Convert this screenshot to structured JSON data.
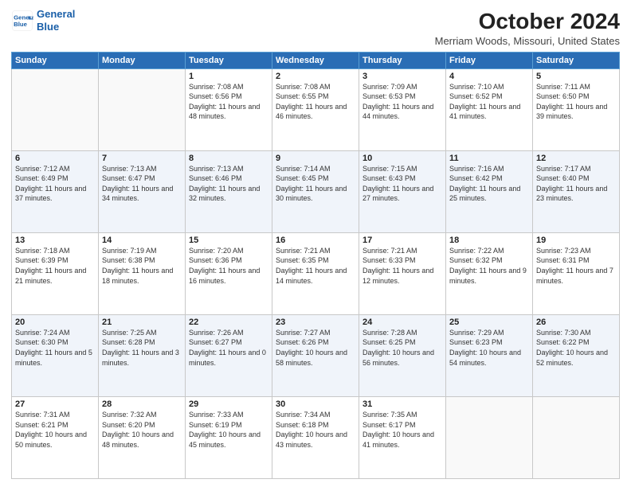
{
  "header": {
    "logo_line1": "General",
    "logo_line2": "Blue",
    "title": "October 2024",
    "subtitle": "Merriam Woods, Missouri, United States"
  },
  "weekdays": [
    "Sunday",
    "Monday",
    "Tuesday",
    "Wednesday",
    "Thursday",
    "Friday",
    "Saturday"
  ],
  "weeks": [
    [
      {
        "day": "",
        "sunrise": "",
        "sunset": "",
        "daylight": ""
      },
      {
        "day": "",
        "sunrise": "",
        "sunset": "",
        "daylight": ""
      },
      {
        "day": "1",
        "sunrise": "Sunrise: 7:08 AM",
        "sunset": "Sunset: 6:56 PM",
        "daylight": "Daylight: 11 hours and 48 minutes."
      },
      {
        "day": "2",
        "sunrise": "Sunrise: 7:08 AM",
        "sunset": "Sunset: 6:55 PM",
        "daylight": "Daylight: 11 hours and 46 minutes."
      },
      {
        "day": "3",
        "sunrise": "Sunrise: 7:09 AM",
        "sunset": "Sunset: 6:53 PM",
        "daylight": "Daylight: 11 hours and 44 minutes."
      },
      {
        "day": "4",
        "sunrise": "Sunrise: 7:10 AM",
        "sunset": "Sunset: 6:52 PM",
        "daylight": "Daylight: 11 hours and 41 minutes."
      },
      {
        "day": "5",
        "sunrise": "Sunrise: 7:11 AM",
        "sunset": "Sunset: 6:50 PM",
        "daylight": "Daylight: 11 hours and 39 minutes."
      }
    ],
    [
      {
        "day": "6",
        "sunrise": "Sunrise: 7:12 AM",
        "sunset": "Sunset: 6:49 PM",
        "daylight": "Daylight: 11 hours and 37 minutes."
      },
      {
        "day": "7",
        "sunrise": "Sunrise: 7:13 AM",
        "sunset": "Sunset: 6:47 PM",
        "daylight": "Daylight: 11 hours and 34 minutes."
      },
      {
        "day": "8",
        "sunrise": "Sunrise: 7:13 AM",
        "sunset": "Sunset: 6:46 PM",
        "daylight": "Daylight: 11 hours and 32 minutes."
      },
      {
        "day": "9",
        "sunrise": "Sunrise: 7:14 AM",
        "sunset": "Sunset: 6:45 PM",
        "daylight": "Daylight: 11 hours and 30 minutes."
      },
      {
        "day": "10",
        "sunrise": "Sunrise: 7:15 AM",
        "sunset": "Sunset: 6:43 PM",
        "daylight": "Daylight: 11 hours and 27 minutes."
      },
      {
        "day": "11",
        "sunrise": "Sunrise: 7:16 AM",
        "sunset": "Sunset: 6:42 PM",
        "daylight": "Daylight: 11 hours and 25 minutes."
      },
      {
        "day": "12",
        "sunrise": "Sunrise: 7:17 AM",
        "sunset": "Sunset: 6:40 PM",
        "daylight": "Daylight: 11 hours and 23 minutes."
      }
    ],
    [
      {
        "day": "13",
        "sunrise": "Sunrise: 7:18 AM",
        "sunset": "Sunset: 6:39 PM",
        "daylight": "Daylight: 11 hours and 21 minutes."
      },
      {
        "day": "14",
        "sunrise": "Sunrise: 7:19 AM",
        "sunset": "Sunset: 6:38 PM",
        "daylight": "Daylight: 11 hours and 18 minutes."
      },
      {
        "day": "15",
        "sunrise": "Sunrise: 7:20 AM",
        "sunset": "Sunset: 6:36 PM",
        "daylight": "Daylight: 11 hours and 16 minutes."
      },
      {
        "day": "16",
        "sunrise": "Sunrise: 7:21 AM",
        "sunset": "Sunset: 6:35 PM",
        "daylight": "Daylight: 11 hours and 14 minutes."
      },
      {
        "day": "17",
        "sunrise": "Sunrise: 7:21 AM",
        "sunset": "Sunset: 6:33 PM",
        "daylight": "Daylight: 11 hours and 12 minutes."
      },
      {
        "day": "18",
        "sunrise": "Sunrise: 7:22 AM",
        "sunset": "Sunset: 6:32 PM",
        "daylight": "Daylight: 11 hours and 9 minutes."
      },
      {
        "day": "19",
        "sunrise": "Sunrise: 7:23 AM",
        "sunset": "Sunset: 6:31 PM",
        "daylight": "Daylight: 11 hours and 7 minutes."
      }
    ],
    [
      {
        "day": "20",
        "sunrise": "Sunrise: 7:24 AM",
        "sunset": "Sunset: 6:30 PM",
        "daylight": "Daylight: 11 hours and 5 minutes."
      },
      {
        "day": "21",
        "sunrise": "Sunrise: 7:25 AM",
        "sunset": "Sunset: 6:28 PM",
        "daylight": "Daylight: 11 hours and 3 minutes."
      },
      {
        "day": "22",
        "sunrise": "Sunrise: 7:26 AM",
        "sunset": "Sunset: 6:27 PM",
        "daylight": "Daylight: 11 hours and 0 minutes."
      },
      {
        "day": "23",
        "sunrise": "Sunrise: 7:27 AM",
        "sunset": "Sunset: 6:26 PM",
        "daylight": "Daylight: 10 hours and 58 minutes."
      },
      {
        "day": "24",
        "sunrise": "Sunrise: 7:28 AM",
        "sunset": "Sunset: 6:25 PM",
        "daylight": "Daylight: 10 hours and 56 minutes."
      },
      {
        "day": "25",
        "sunrise": "Sunrise: 7:29 AM",
        "sunset": "Sunset: 6:23 PM",
        "daylight": "Daylight: 10 hours and 54 minutes."
      },
      {
        "day": "26",
        "sunrise": "Sunrise: 7:30 AM",
        "sunset": "Sunset: 6:22 PM",
        "daylight": "Daylight: 10 hours and 52 minutes."
      }
    ],
    [
      {
        "day": "27",
        "sunrise": "Sunrise: 7:31 AM",
        "sunset": "Sunset: 6:21 PM",
        "daylight": "Daylight: 10 hours and 50 minutes."
      },
      {
        "day": "28",
        "sunrise": "Sunrise: 7:32 AM",
        "sunset": "Sunset: 6:20 PM",
        "daylight": "Daylight: 10 hours and 48 minutes."
      },
      {
        "day": "29",
        "sunrise": "Sunrise: 7:33 AM",
        "sunset": "Sunset: 6:19 PM",
        "daylight": "Daylight: 10 hours and 45 minutes."
      },
      {
        "day": "30",
        "sunrise": "Sunrise: 7:34 AM",
        "sunset": "Sunset: 6:18 PM",
        "daylight": "Daylight: 10 hours and 43 minutes."
      },
      {
        "day": "31",
        "sunrise": "Sunrise: 7:35 AM",
        "sunset": "Sunset: 6:17 PM",
        "daylight": "Daylight: 10 hours and 41 minutes."
      },
      {
        "day": "",
        "sunrise": "",
        "sunset": "",
        "daylight": ""
      },
      {
        "day": "",
        "sunrise": "",
        "sunset": "",
        "daylight": ""
      }
    ]
  ]
}
